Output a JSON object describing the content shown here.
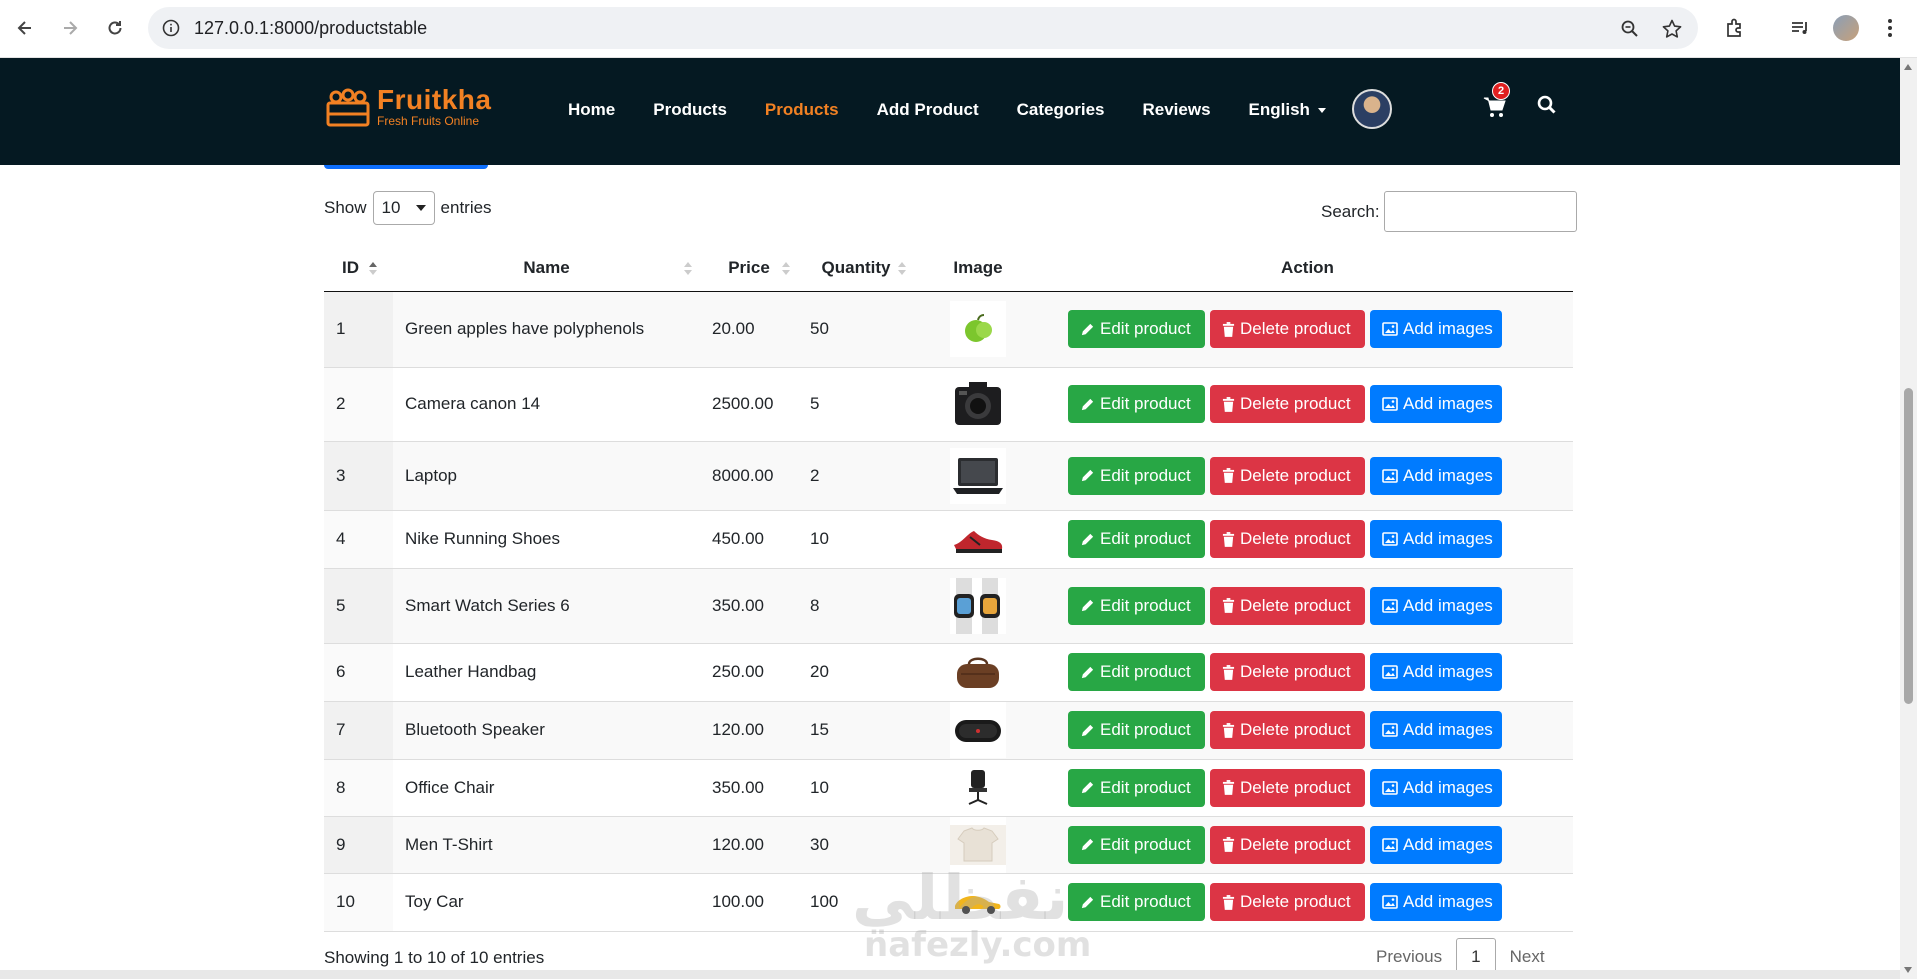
{
  "browser": {
    "url": "127.0.0.1:8000/productstable",
    "icons": [
      "back-icon",
      "forward-icon",
      "reload-icon",
      "site-info-icon",
      "zoom-icon",
      "bookmark-star-icon",
      "extensions-icon",
      "media-icon",
      "profile-avatar",
      "kebab-menu-icon"
    ]
  },
  "header": {
    "brand": "Fruitkha",
    "tagline": "Fresh Fruits Online",
    "menu": [
      {
        "label": "Home"
      },
      {
        "label": "Products"
      },
      {
        "label": "Products",
        "active": true
      },
      {
        "label": "Add Product"
      },
      {
        "label": "Categories"
      },
      {
        "label": "Reviews"
      },
      {
        "label": "English",
        "dropdown": true
      }
    ],
    "cart_count": "2",
    "accent_color": "#f28123",
    "background": "#051922"
  },
  "table_controls": {
    "show_label": "Show",
    "entries_value": "10",
    "entries_label": "entries",
    "search_label": "Search:"
  },
  "table": {
    "columns": [
      "ID",
      "Name",
      "Price",
      "Quantity",
      "Image",
      "Action"
    ],
    "rows": [
      {
        "id": "1",
        "name": "Green apples have polyphenols",
        "price": "20.00",
        "quantity": "50",
        "image": "apple"
      },
      {
        "id": "2",
        "name": "Camera canon 14",
        "price": "2500.00",
        "quantity": "5",
        "image": "camera"
      },
      {
        "id": "3",
        "name": "Laptop",
        "price": "8000.00",
        "quantity": "2",
        "image": "laptop"
      },
      {
        "id": "4",
        "name": "Nike Running Shoes",
        "price": "450.00",
        "quantity": "10",
        "image": "shoe"
      },
      {
        "id": "5",
        "name": "Smart Watch Series 6",
        "price": "350.00",
        "quantity": "8",
        "image": "watch"
      },
      {
        "id": "6",
        "name": "Leather Handbag",
        "price": "250.00",
        "quantity": "20",
        "image": "bag"
      },
      {
        "id": "7",
        "name": "Bluetooth Speaker",
        "price": "120.00",
        "quantity": "15",
        "image": "speaker"
      },
      {
        "id": "8",
        "name": "Office Chair",
        "price": "350.00",
        "quantity": "10",
        "image": "chair"
      },
      {
        "id": "9",
        "name": "Men T-Shirt",
        "price": "120.00",
        "quantity": "30",
        "image": "tshirt"
      },
      {
        "id": "10",
        "name": "Toy Car",
        "price": "100.00",
        "quantity": "100",
        "image": "car"
      }
    ],
    "actions": {
      "edit": "Edit product",
      "delete": "Delete product",
      "add_images": "Add images"
    },
    "action_colors": {
      "edit": "#28a745",
      "delete": "#dc3545",
      "add_images": "#007bff"
    }
  },
  "footer": {
    "info": "Showing 1 to 10 of 10 entries",
    "previous": "Previous",
    "current_page": "1",
    "next": "Next"
  },
  "watermark": {
    "arabic": "نفظلي",
    "latin": "nafezly.com"
  }
}
